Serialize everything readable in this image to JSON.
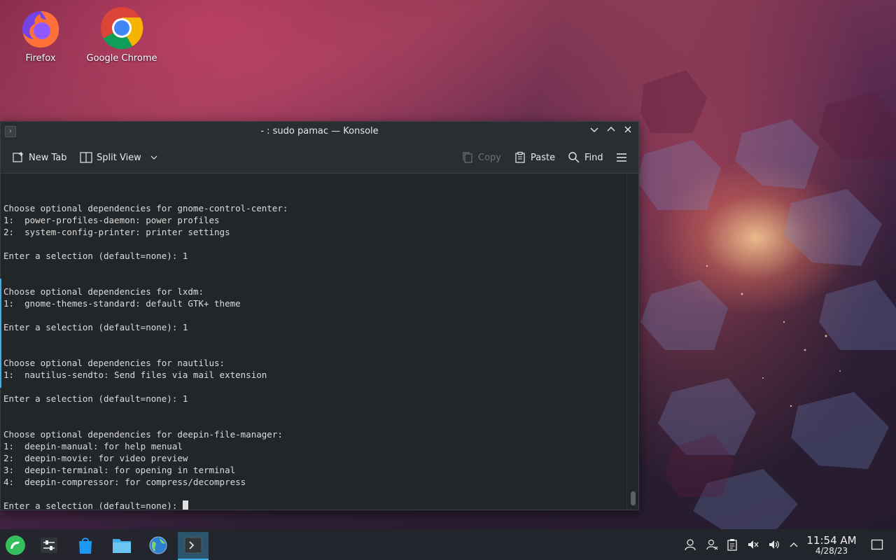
{
  "desktop": {
    "icons": [
      {
        "label": "Firefox",
        "icon": "firefox-icon"
      },
      {
        "label": "Google Chrome",
        "icon": "chrome-icon"
      }
    ]
  },
  "window": {
    "title": "- : sudo pamac — Konsole",
    "app_icon": "konsole-icon"
  },
  "toolbar": {
    "new_tab_label": "New Tab",
    "split_view_label": "Split View",
    "copy_label": "Copy",
    "paste_label": "Paste",
    "find_label": "Find"
  },
  "terminal": {
    "lines": [
      "",
      "",
      "Choose optional dependencies for gnome-control-center:",
      "1:  power-profiles-daemon: power profiles",
      "2:  system-config-printer: printer settings",
      "",
      "Enter a selection (default=none): 1",
      "",
      "",
      "Choose optional dependencies for lxdm:",
      "1:  gnome-themes-standard: default GTK+ theme",
      "",
      "Enter a selection (default=none): 1",
      "",
      "",
      "Choose optional dependencies for nautilus:",
      "1:  nautilus-sendto: Send files via mail extension",
      "",
      "Enter a selection (default=none): 1",
      "",
      "",
      "Choose optional dependencies for deepin-file-manager:",
      "1:  deepin-manual: for help menual",
      "2:  deepin-movie: for video preview",
      "3:  deepin-terminal: for opening in terminal",
      "4:  deepin-compressor: for compress/decompress",
      ""
    ],
    "prompt": "Enter a selection (default=none): "
  },
  "taskbar": {
    "items": [
      "app-launcher-icon",
      "system-settings-icon",
      "discover-store-icon",
      "file-manager-icon",
      "browser-globe-icon",
      "konsole-icon"
    ],
    "tray": [
      "user-icon",
      "user-switch-icon",
      "clipboard-icon",
      "volume-muted-icon",
      "volume-icon",
      "tray-expand-icon"
    ],
    "time": "11:54 AM",
    "date": "4/28/23"
  },
  "colors": {
    "accent": "#3daee9",
    "terminal_bg": "#232629",
    "terminal_fg": "#dcdcdc"
  }
}
